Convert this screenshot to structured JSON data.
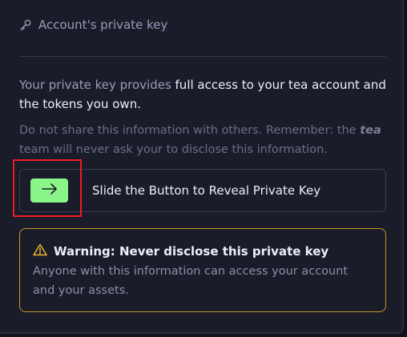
{
  "header": {
    "title": "Account's private key",
    "icon": "key-icon"
  },
  "info": {
    "intro": "Your private key provides ",
    "intro_strong": "full access to your tea account and the tokens you own.",
    "caution_before": "Do not share this information with others. Remember: the ",
    "caution_brand": "tea",
    "caution_after": " team will never ask your to disclose this information."
  },
  "slider": {
    "label": "Slide the Button to Reveal Private Key",
    "button_icon": "arrow-right-icon",
    "button_color": "#8cf58a"
  },
  "warning": {
    "icon": "warning-triangle-icon",
    "title": "Warning: Never disclose this private key",
    "text": "Anyone with this information can access your account and your assets.",
    "accent_color": "#c59a1e"
  },
  "highlight": {
    "color": "#ea1d24"
  }
}
